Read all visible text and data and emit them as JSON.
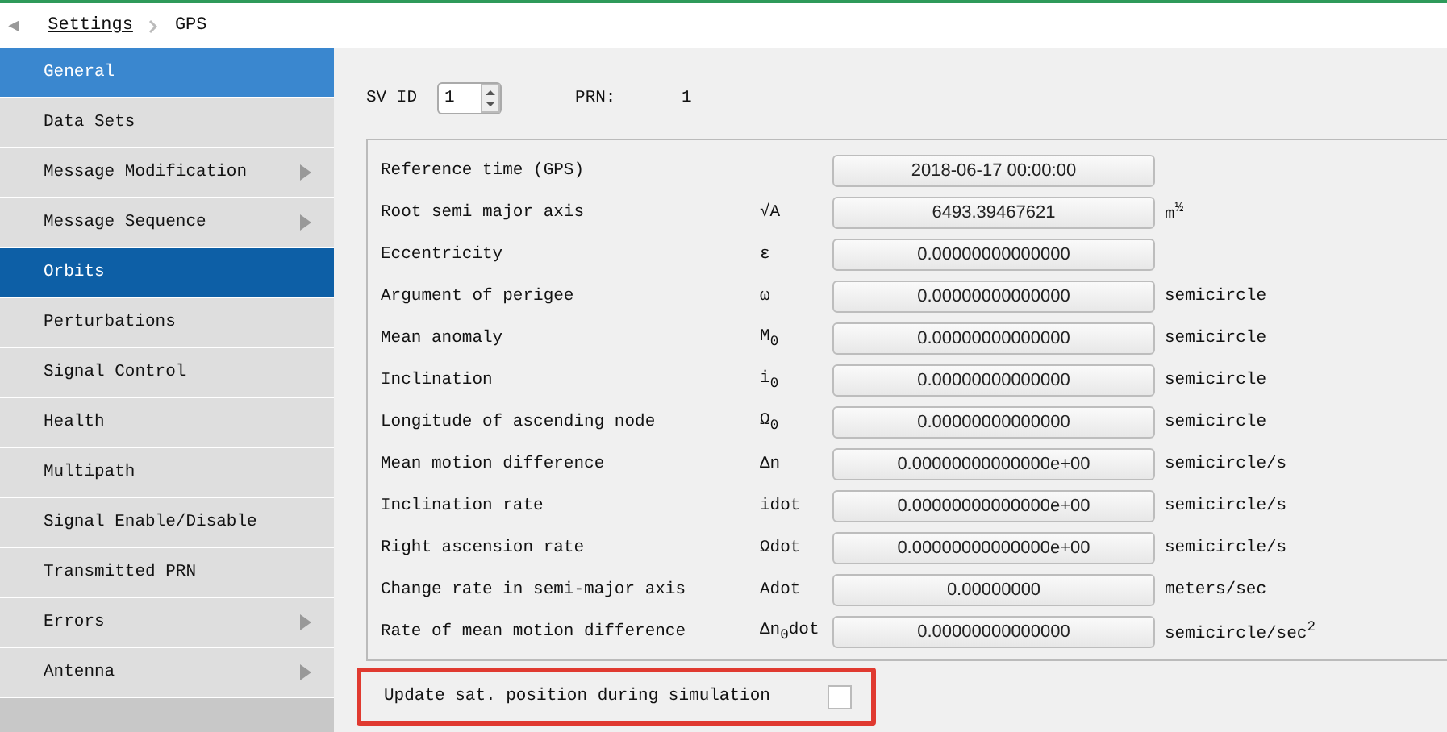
{
  "breadcrumb": {
    "back_icon": "◀",
    "items": [
      {
        "label": "Settings",
        "link": true
      },
      {
        "label": "GPS",
        "link": false
      }
    ]
  },
  "sidebar": {
    "items": [
      {
        "label": "General",
        "selected": false,
        "hovered": true,
        "submenu": false
      },
      {
        "label": "Data Sets",
        "selected": false,
        "hovered": false,
        "submenu": false
      },
      {
        "label": "Message Modification",
        "selected": false,
        "hovered": false,
        "submenu": true
      },
      {
        "label": "Message Sequence",
        "selected": false,
        "hovered": false,
        "submenu": true
      },
      {
        "label": "Orbits",
        "selected": true,
        "hovered": false,
        "submenu": false
      },
      {
        "label": "Perturbations",
        "selected": false,
        "hovered": false,
        "submenu": false
      },
      {
        "label": "Signal Control",
        "selected": false,
        "hovered": false,
        "submenu": false
      },
      {
        "label": "Health",
        "selected": false,
        "hovered": false,
        "submenu": false
      },
      {
        "label": "Multipath",
        "selected": false,
        "hovered": false,
        "submenu": false
      },
      {
        "label": "Signal Enable/Disable",
        "selected": false,
        "hovered": false,
        "submenu": false
      },
      {
        "label": "Transmitted PRN",
        "selected": false,
        "hovered": false,
        "submenu": false
      },
      {
        "label": "Errors",
        "selected": false,
        "hovered": false,
        "submenu": true
      },
      {
        "label": "Antenna",
        "selected": false,
        "hovered": false,
        "submenu": true
      }
    ]
  },
  "sv_id": {
    "label": "SV ID",
    "value": "1"
  },
  "prn": {
    "label": "PRN:",
    "value": "1"
  },
  "parameters": [
    {
      "label": "Reference time (GPS)",
      "value": "2018-06-17 00:00:00"
    },
    {
      "label": "Root semi major axis",
      "symbol": "√A",
      "value": "6493.39467621",
      "unit": "m$^{½}$"
    },
    {
      "label": "Eccentricity",
      "symbol": "ε",
      "value": "0.00000000000000"
    },
    {
      "label": "Argument of perigee",
      "symbol": "ω",
      "value": "0.00000000000000",
      "unit": "semicircle"
    },
    {
      "label": "Mean anomaly",
      "symbol": "M$_{0}$",
      "value": "0.00000000000000",
      "unit": "semicircle"
    },
    {
      "label": "Inclination",
      "symbol": "i$_{0}$",
      "value": "0.00000000000000",
      "unit": "semicircle"
    },
    {
      "label": "Longitude of ascending node",
      "symbol": "Ω$_{0}$",
      "value": "0.00000000000000",
      "unit": "semicircle"
    },
    {
      "label": "Mean motion difference",
      "symbol": "Δn",
      "value": "0.00000000000000e+00",
      "unit": "semicircle/s"
    },
    {
      "label": "Inclination rate",
      "symbol": "idot",
      "value": "0.00000000000000e+00",
      "unit": "semicircle/s"
    },
    {
      "label": "Right ascension rate",
      "symbol": "Ωdot",
      "value": "0.00000000000000e+00",
      "unit": "semicircle/s"
    },
    {
      "label": "Change rate in semi-major axis",
      "symbol": "Adot",
      "value": "0.00000000",
      "unit": "meters/sec"
    },
    {
      "label": "Rate of mean motion difference",
      "symbol": "Δn$_{0}$dot",
      "value": "0.00000000000000",
      "unit": "semicircle/sec$^{2}$"
    }
  ],
  "update_option": {
    "label": "Update sat. position during simulation",
    "checked": false,
    "highlighted": true
  }
}
